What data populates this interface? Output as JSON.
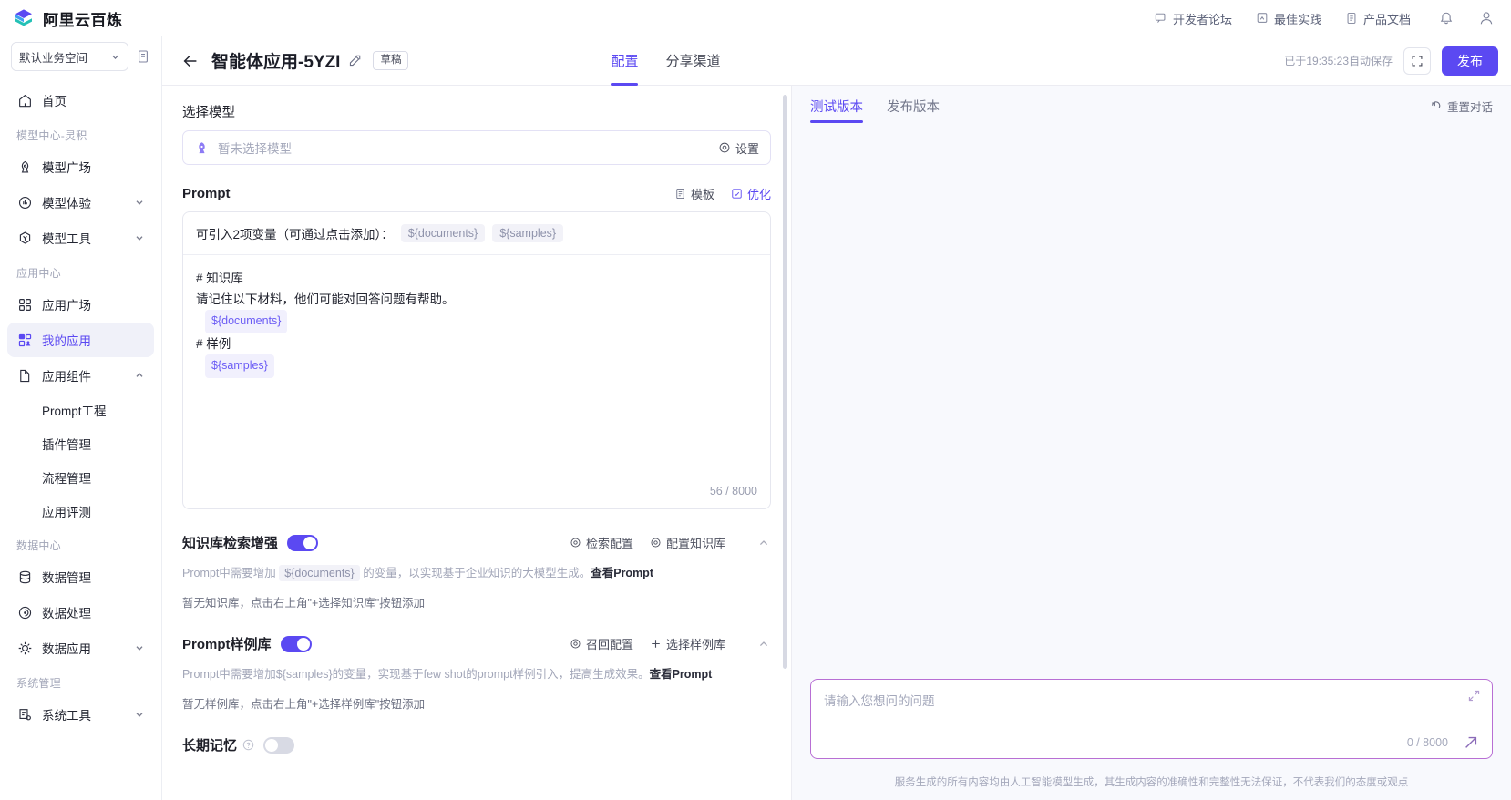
{
  "brand": {
    "name": "阿里云百炼",
    "logo_icon": "bailian-logo-icon"
  },
  "topnav": {
    "items": [
      {
        "label": "开发者论坛",
        "icon": "forum-icon"
      },
      {
        "label": "最佳实践",
        "icon": "lightbulb-doc-icon"
      },
      {
        "label": "产品文档",
        "icon": "document-icon"
      }
    ],
    "bell_icon": "bell-icon",
    "avatar_icon": "user-avatar-icon"
  },
  "sidebar": {
    "workspace": {
      "label": "默认业务空间",
      "chevron_icon": "chevron-down-icon",
      "doc_icon": "doc-page-icon"
    },
    "groups": [
      {
        "title": null,
        "items": [
          {
            "label": "首页",
            "icon": "home-icon",
            "active": false,
            "expandable": false
          }
        ]
      },
      {
        "title": "模型中心-灵积",
        "items": [
          {
            "label": "模型广场",
            "icon": "model-square-icon",
            "active": false,
            "expandable": false
          },
          {
            "label": "模型体验",
            "icon": "model-experience-icon",
            "active": false,
            "expandable": true
          },
          {
            "label": "模型工具",
            "icon": "model-tools-icon",
            "active": false,
            "expandable": true
          }
        ]
      },
      {
        "title": "应用中心",
        "items": [
          {
            "label": "应用广场",
            "icon": "app-square-icon",
            "active": false,
            "expandable": false
          },
          {
            "label": "我的应用",
            "icon": "my-apps-icon",
            "active": true,
            "expandable": false
          },
          {
            "label": "应用组件",
            "icon": "app-components-icon",
            "active": false,
            "expandable": true,
            "expanded": true,
            "children": [
              {
                "label": "Prompt工程"
              },
              {
                "label": "插件管理"
              },
              {
                "label": "流程管理"
              },
              {
                "label": "应用评测"
              }
            ]
          }
        ]
      },
      {
        "title": "数据中心",
        "items": [
          {
            "label": "数据管理",
            "icon": "database-icon",
            "active": false,
            "expandable": false
          },
          {
            "label": "数据处理",
            "icon": "data-process-icon",
            "active": false,
            "expandable": false
          },
          {
            "label": "数据应用",
            "icon": "data-app-icon",
            "active": false,
            "expandable": true
          }
        ]
      },
      {
        "title": "系统管理",
        "items": [
          {
            "label": "系统工具",
            "icon": "system-tools-icon",
            "active": false,
            "expandable": true
          }
        ]
      }
    ]
  },
  "header": {
    "back_icon": "back-arrow-icon",
    "title": "智能体应用-5YZI",
    "edit_icon": "edit-pencil-icon",
    "status_badge": "草稿",
    "tabs": [
      {
        "label": "配置",
        "active": true
      },
      {
        "label": "分享渠道",
        "active": false
      }
    ],
    "autosave": "已于19:35:23自动保存",
    "expand_icon": "fullscreen-icon",
    "publish_label": "发布"
  },
  "config": {
    "model_section": {
      "label": "选择模型",
      "placeholder": "暂未选择模型",
      "model_icon": "model-chip-icon",
      "setting_label": "设置",
      "setting_icon": "gear-icon"
    },
    "prompt_section": {
      "title": "Prompt",
      "actions": [
        {
          "label": "模板",
          "icon": "template-icon",
          "accent": false
        },
        {
          "label": "优化",
          "icon": "optimize-icon",
          "accent": true
        }
      ],
      "vars_hint": "可引入2项变量（可通过点击添加）：",
      "vars": [
        "${documents}",
        "${samples}"
      ],
      "content_lines": [
        {
          "type": "text",
          "text": "# 知识库"
        },
        {
          "type": "text",
          "text": "请记住以下材料，他们可能对回答问题有帮助。"
        },
        {
          "type": "var",
          "text": "${documents}"
        },
        {
          "type": "text",
          "text": "# 样例"
        },
        {
          "type": "var",
          "text": "${samples}"
        }
      ],
      "counter": "56 / 8000"
    },
    "kb_section": {
      "title": "知识库检索增强",
      "toggle_on": true,
      "actions": [
        {
          "label": "检索配置",
          "icon": "gear-icon"
        },
        {
          "label": "配置知识库",
          "icon": "gear-icon"
        }
      ],
      "collapse_icon": "chevron-up-icon",
      "hint_prefix": "Prompt中需要增加",
      "hint_chip": "${documents}",
      "hint_suffix": "的变量，以实现基于企业知识的大模型生成。",
      "hint_link": "查看Prompt",
      "empty_text": "暂无知识库，点击右上角\"+选择知识库\"按钮添加"
    },
    "samples_section": {
      "title": "Prompt样例库",
      "toggle_on": true,
      "actions": [
        {
          "label": "召回配置",
          "icon": "gear-icon"
        },
        {
          "label": "选择样例库",
          "icon": "plus-icon"
        }
      ],
      "collapse_icon": "chevron-up-icon",
      "hint_prefix": "Prompt中需要增加${samples}的变量，实现基于few shot的prompt样例引入，提高生成效果。",
      "hint_link": "查看Prompt",
      "empty_text": "暂无样例库，点击右上角\"+选择样例库\"按钮添加"
    },
    "memory_section": {
      "title": "长期记忆",
      "help_icon": "question-circle-icon",
      "toggle_on": false
    }
  },
  "chat": {
    "tabs": [
      {
        "label": "测试版本",
        "active": true
      },
      {
        "label": "发布版本",
        "active": false
      }
    ],
    "reset_label": "重置对话",
    "reset_icon": "reset-icon",
    "input_placeholder": "请输入您想问的问题",
    "input_value": "",
    "counter": "0 / 8000",
    "expand_icon": "expand-corner-icon",
    "send_icon": "send-arrow-icon",
    "disclaimer": "服务生成的所有内容均由人工智能模型生成，其生成内容的准确性和完整性无法保证，不代表我们的态度或观点"
  },
  "colors": {
    "accent": "#5b49f2",
    "accent_light": "#f0f1f9",
    "chat_bg": "#f8f9fd",
    "input_border": "#b86fd4",
    "muted": "#a2a6b8"
  }
}
